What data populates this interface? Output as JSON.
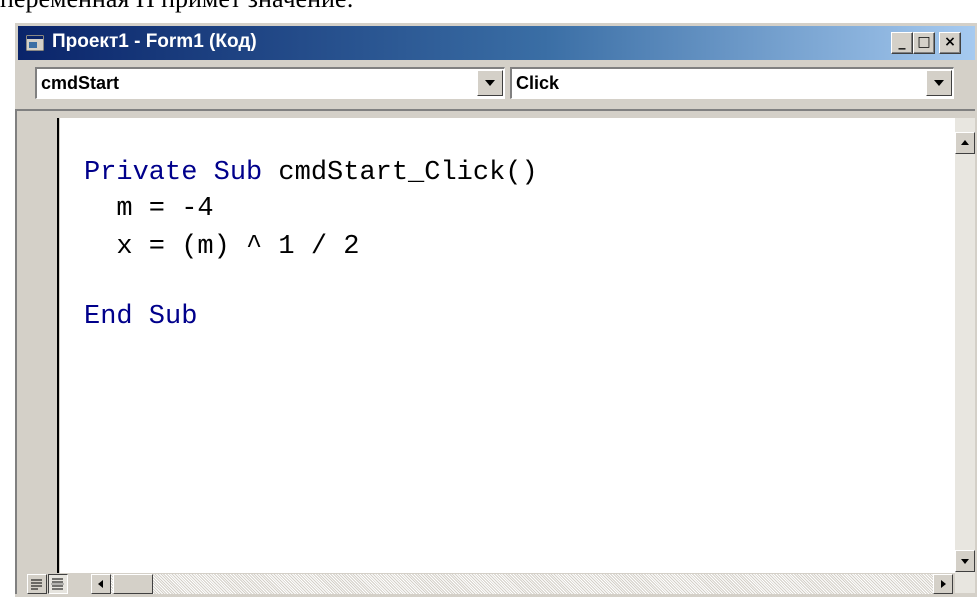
{
  "caption": "переменная H примет значение:",
  "window": {
    "title": "Проект1 - Form1 (Код)",
    "minimize_label": "_",
    "maximize_label": "□",
    "close_label": "×"
  },
  "object_combo": {
    "value": "cmdStart"
  },
  "procedure_combo": {
    "value": "Click"
  },
  "code": {
    "line1_keyword": "Private Sub",
    "line1_rest": " cmdStart_Click()",
    "line2": "  m = -4",
    "line3": "  x = (m) ^ 1 / 2",
    "line4": "End Sub"
  },
  "icons": {
    "window": "form-window-icon",
    "combo_arrow": "chevron-down-icon",
    "scroll_up": "arrow-up-icon",
    "scroll_down": "arrow-down-icon",
    "scroll_left": "arrow-left-icon",
    "scroll_right": "arrow-right-icon",
    "procedure_view": "procedure-view-icon",
    "full_module_view": "full-module-view-icon"
  },
  "colors": {
    "titlebar_start": "#0a246a",
    "titlebar_end": "#a6caf0",
    "keyword": "#00008b",
    "face": "#d4d0c8"
  }
}
